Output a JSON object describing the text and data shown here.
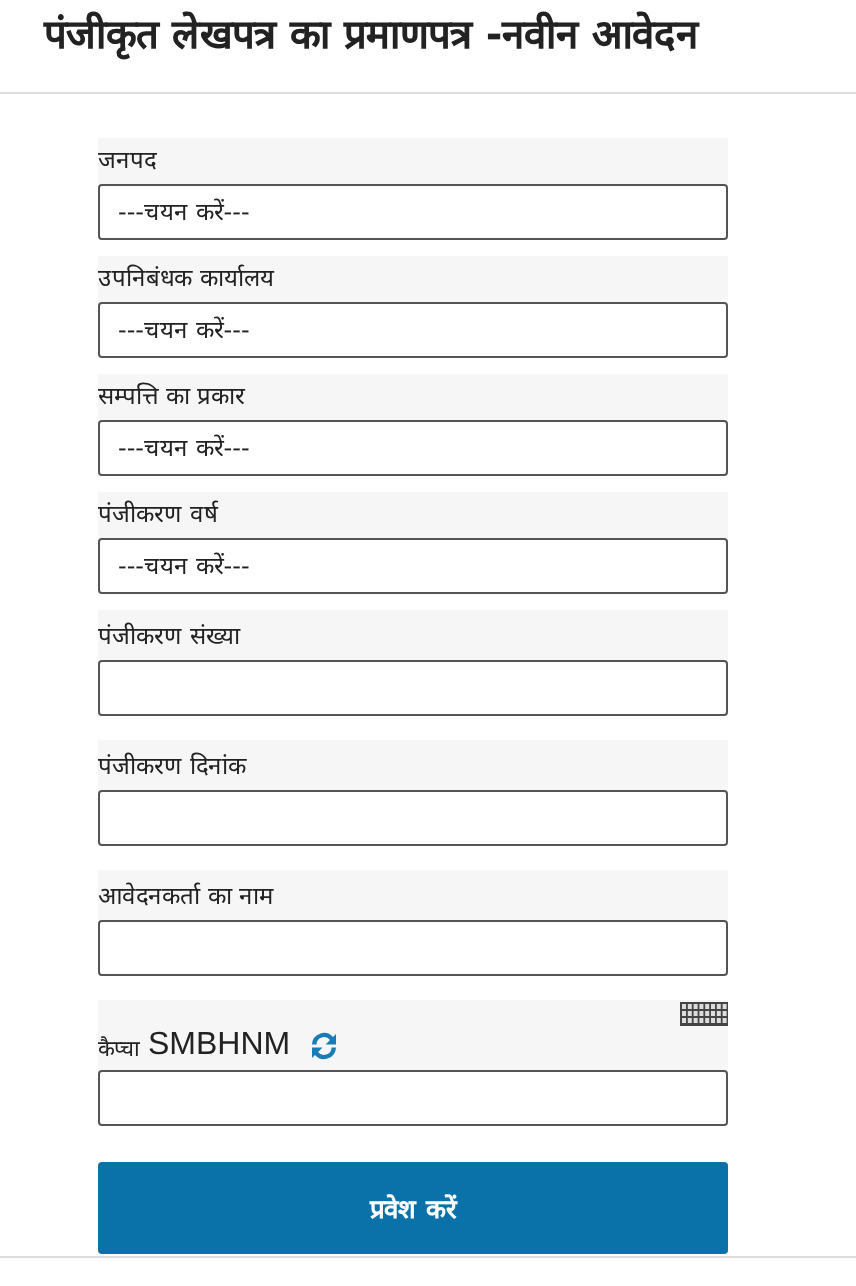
{
  "page": {
    "title": "पंजीकृत लेखपत्र का प्रमाणपत्र -नवीन आवेदन"
  },
  "fields": [
    {
      "kind": "select",
      "label": "जनपद",
      "value": "---चयन करें---"
    },
    {
      "kind": "select",
      "label": "उपनिबंधक कार्यालय",
      "value": "---चयन करें---"
    },
    {
      "kind": "select",
      "label": "सम्पत्ति का प्रकार",
      "value": "---चयन करें---"
    },
    {
      "kind": "select",
      "label": "पंजीकरण वर्ष",
      "value": "---चयन करें---"
    },
    {
      "kind": "text",
      "label": "पंजीकरण संख्या"
    },
    {
      "kind": "text",
      "label": "पंजीकरण दिनांक"
    },
    {
      "kind": "text",
      "label": "आवेदनकर्ता का नाम"
    }
  ],
  "captcha": {
    "label": "कैप्चा",
    "code": "SMBHNM"
  },
  "submit": {
    "label": "प्रवेश करें"
  }
}
